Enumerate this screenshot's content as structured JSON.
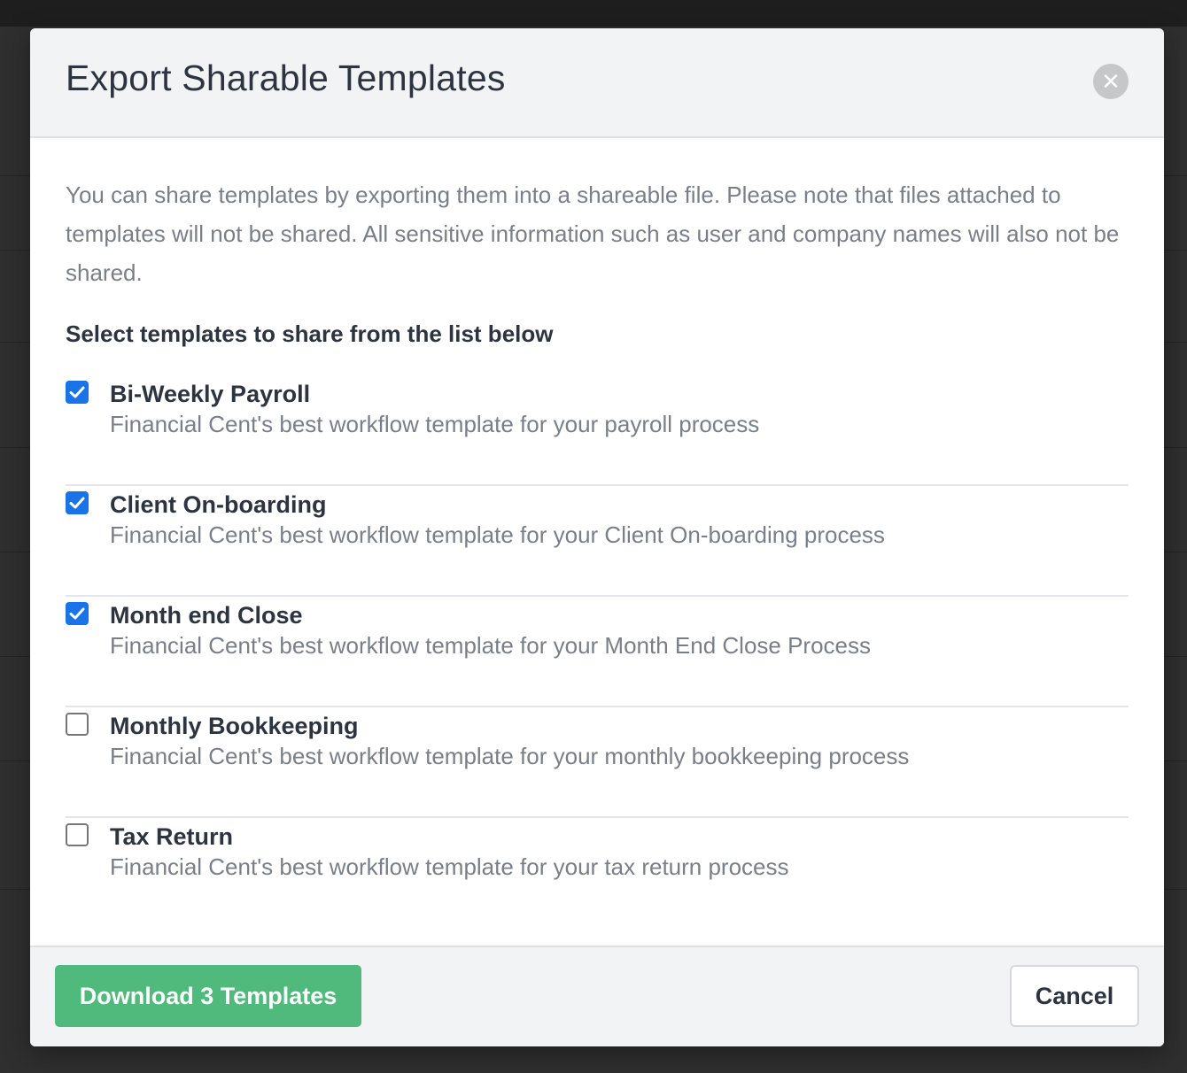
{
  "modal": {
    "title": "Export Sharable Templates",
    "close_icon": "close-icon",
    "intro": "You can share templates by exporting them into a shareable file. Please note that files attached to templates will not be shared. All sensitive information such as user and company names will also not be shared.",
    "select_heading": "Select templates to share from the list below"
  },
  "templates": [
    {
      "name": "Bi-Weekly Payroll",
      "description": "Financial Cent's best workflow template for your payroll process",
      "checked": true
    },
    {
      "name": "Client On-boarding",
      "description": "Financial Cent's best workflow template for your Client On-boarding process",
      "checked": true
    },
    {
      "name": "Month end Close",
      "description": "Financial Cent's best workflow template for your Month End Close Process",
      "checked": true
    },
    {
      "name": "Monthly Bookkeeping",
      "description": "Financial Cent's best workflow template for your monthly bookkeeping process",
      "checked": false
    },
    {
      "name": "Tax Return",
      "description": "Financial Cent's best workflow template for your tax return process",
      "checked": false
    }
  ],
  "footer": {
    "download_label": "Download 3 Templates",
    "cancel_label": "Cancel"
  },
  "colors": {
    "checkbox_checked": "#1a73e8",
    "download_button": "#4fba7c",
    "overlay": "#2f2f2f"
  }
}
